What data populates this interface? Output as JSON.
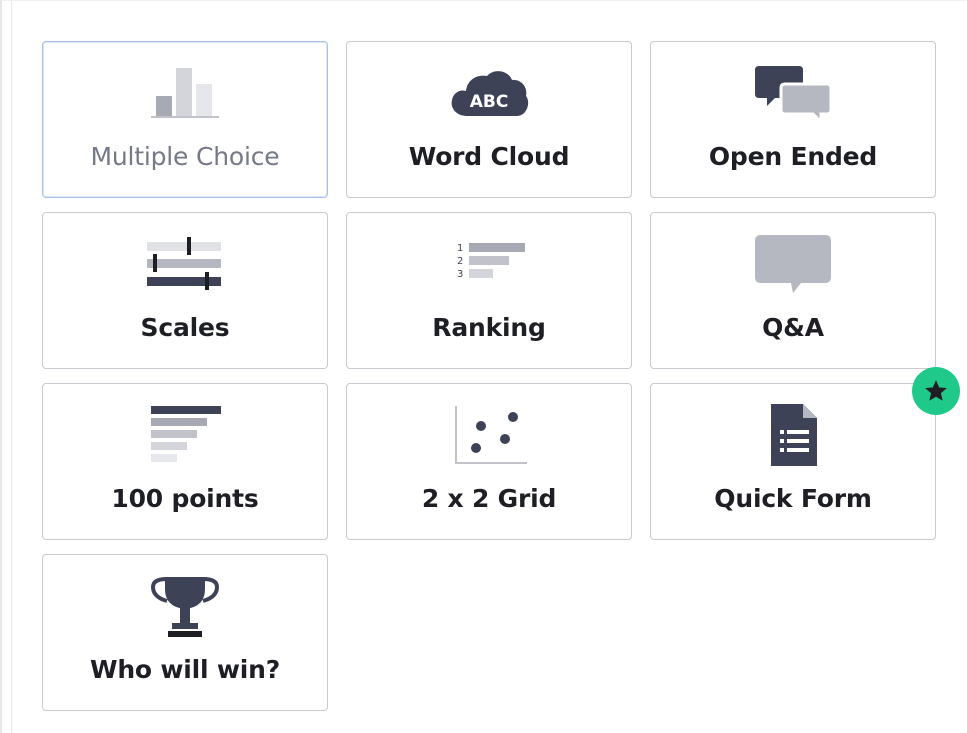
{
  "question_types": [
    {
      "label": "Multiple Choice",
      "icon": "bar-chart-icon",
      "selected": true
    },
    {
      "label": "Word Cloud",
      "icon": "word-cloud-icon",
      "icon_text": "ABC"
    },
    {
      "label": "Open Ended",
      "icon": "speech-bubbles-icon"
    },
    {
      "label": "Scales",
      "icon": "sliders-icon"
    },
    {
      "label": "Ranking",
      "icon": "ranking-icon",
      "icon_numbers": [
        "1",
        "2",
        "3"
      ]
    },
    {
      "label": "Q&A",
      "icon": "chat-bubble-icon"
    },
    {
      "label": "100 points",
      "icon": "horizontal-bars-icon"
    },
    {
      "label": "2 x 2 Grid",
      "icon": "scatter-plot-icon"
    },
    {
      "label": "Quick Form",
      "icon": "document-icon",
      "badge": "star-icon"
    },
    {
      "label": "Who will win?",
      "icon": "trophy-icon"
    }
  ],
  "colors": {
    "icon_dark": "#3d4257",
    "icon_mid": "#b1b3bd",
    "icon_light": "#e1e2e6",
    "badge": "#1ec98a",
    "selected_border": "#a9c1e6",
    "tile_border": "#c9c9cf"
  }
}
